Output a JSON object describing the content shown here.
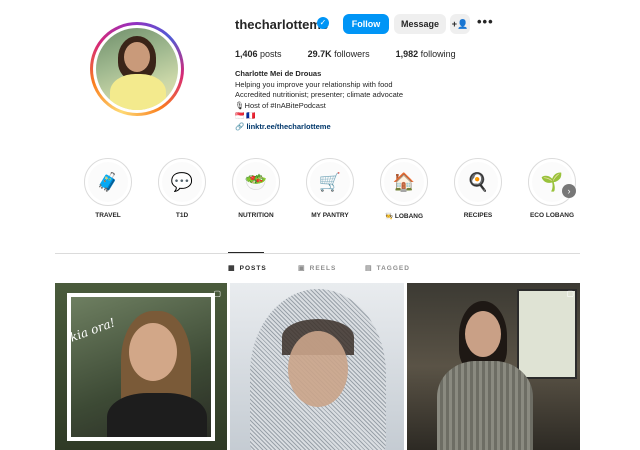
{
  "profile": {
    "username": "thecharlotteme",
    "verified_icon": "verified-badge-icon",
    "follow_label": "Follow",
    "message_label": "Message",
    "add_user_icon": "add-user-icon",
    "more_icon": "more-options-icon"
  },
  "stats": {
    "posts_count": "1,406",
    "posts_label": "posts",
    "followers_count": "29.7K",
    "followers_label": "followers",
    "following_count": "1,982",
    "following_label": "following"
  },
  "bio": {
    "name": "Charlotte Mei de Drouas",
    "line1": "Helping you improve your relationship with food",
    "line2": "Accredited nutritionist; presenter; climate advocate",
    "line3": "🎙Host of #InABitePodcast",
    "line4": "🇸🇬 🇫🇷",
    "link": "linktr.ee/thecharlotteme"
  },
  "highlights": [
    {
      "label": "TRAVEL",
      "icon": "🧳"
    },
    {
      "label": "T1D",
      "icon": "💬"
    },
    {
      "label": "NUTRITION",
      "icon": "🥗"
    },
    {
      "label": "MY PANTRY",
      "icon": "🛒"
    },
    {
      "label": "🧑‍🍳 LOBANG",
      "icon": "🏠"
    },
    {
      "label": "RECIPES",
      "icon": "🍳"
    },
    {
      "label": "ECO LOBANG",
      "icon": "🌱"
    }
  ],
  "tabs": {
    "posts": "POSTS",
    "reels": "REELS",
    "tagged": "TAGGED"
  },
  "posts": [
    {
      "overlay_text": "kia ora!"
    },
    {
      "overlay_text": ""
    },
    {
      "overlay_text": ""
    }
  ],
  "colors": {
    "accent": "#0095f6",
    "text": "#262626",
    "muted": "#8e8e8e"
  }
}
